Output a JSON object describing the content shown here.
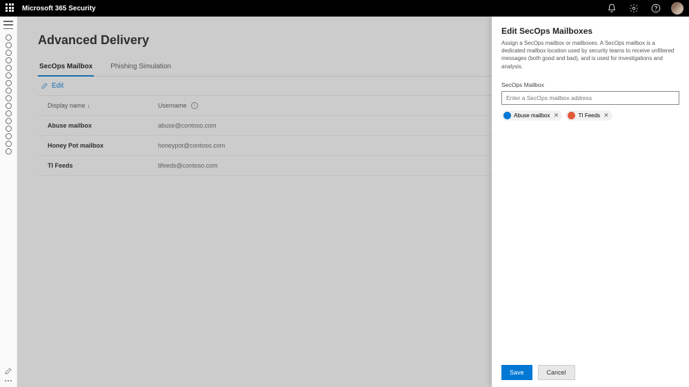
{
  "header": {
    "app_title": "Microsoft 365 Security"
  },
  "sidebar": {
    "item_count": 16
  },
  "page": {
    "title": "Advanced Delivery",
    "tabs": [
      {
        "label": "SecOps Mailbox",
        "active": true
      },
      {
        "label": "Phishing Simulation",
        "active": false
      }
    ],
    "toolbar": {
      "edit_label": "Edit"
    },
    "table": {
      "headers": {
        "name": "Display name",
        "sort_indicator": "↓",
        "username": "Username"
      },
      "rows": [
        {
          "name": "Abuse mailbox",
          "username": "abuse@contoso.com"
        },
        {
          "name": "Honey Pot mailbox",
          "username": "honeypot@contoso.com"
        },
        {
          "name": "TI Feeds",
          "username": "tifeeds@contoso.com"
        }
      ]
    }
  },
  "panel": {
    "title": "Edit SecOps Mailboxes",
    "description": "Assign a SecOps mailbox or mailboxes. A SecOps mailbox is a dedicated mailbox location used by security teams to receive unfiltered messages (both good and bad), and is used for investigations and analysis.",
    "field_label": "SecOps Mailbox",
    "input_placeholder": "Enter a SecOps mailbox address",
    "chips": [
      {
        "label": "Abuse mailbox",
        "color": "#0078d4"
      },
      {
        "label": "TI Feeds",
        "color": "#e05b3a"
      }
    ],
    "buttons": {
      "save": "Save",
      "cancel": "Cancel"
    }
  }
}
